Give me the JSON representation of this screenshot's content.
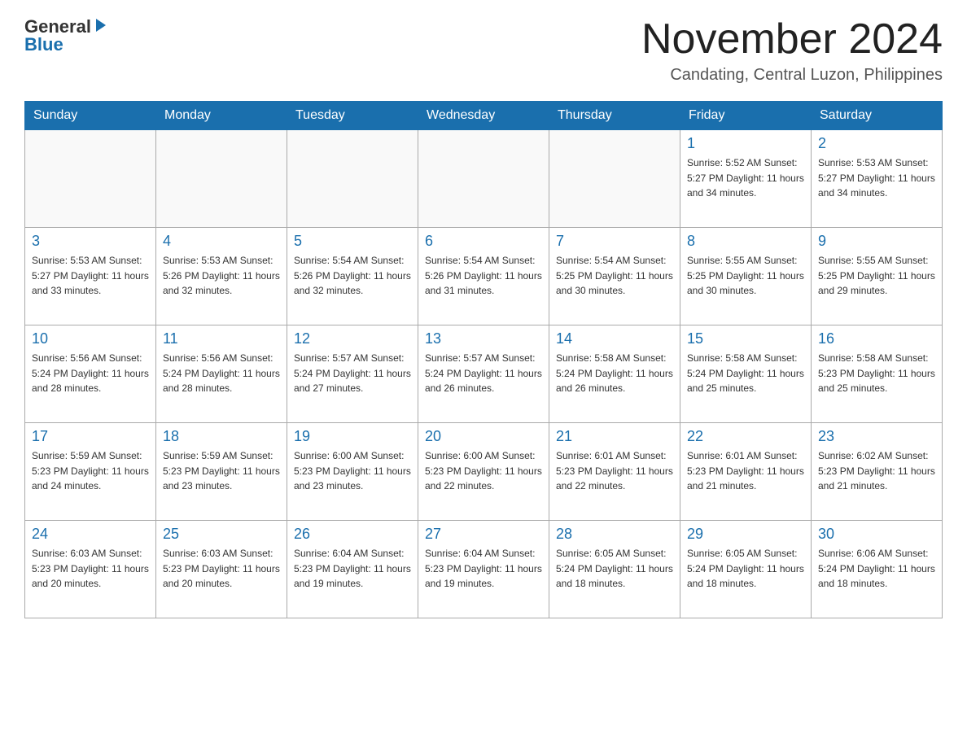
{
  "header": {
    "logo": {
      "general": "General",
      "blue": "Blue",
      "arrow": "▶"
    },
    "title": "November 2024",
    "location": "Candating, Central Luzon, Philippines"
  },
  "calendar": {
    "days_of_week": [
      "Sunday",
      "Monday",
      "Tuesday",
      "Wednesday",
      "Thursday",
      "Friday",
      "Saturday"
    ],
    "weeks": [
      [
        {
          "day": "",
          "info": ""
        },
        {
          "day": "",
          "info": ""
        },
        {
          "day": "",
          "info": ""
        },
        {
          "day": "",
          "info": ""
        },
        {
          "day": "",
          "info": ""
        },
        {
          "day": "1",
          "info": "Sunrise: 5:52 AM\nSunset: 5:27 PM\nDaylight: 11 hours\nand 34 minutes."
        },
        {
          "day": "2",
          "info": "Sunrise: 5:53 AM\nSunset: 5:27 PM\nDaylight: 11 hours\nand 34 minutes."
        }
      ],
      [
        {
          "day": "3",
          "info": "Sunrise: 5:53 AM\nSunset: 5:27 PM\nDaylight: 11 hours\nand 33 minutes."
        },
        {
          "day": "4",
          "info": "Sunrise: 5:53 AM\nSunset: 5:26 PM\nDaylight: 11 hours\nand 32 minutes."
        },
        {
          "day": "5",
          "info": "Sunrise: 5:54 AM\nSunset: 5:26 PM\nDaylight: 11 hours\nand 32 minutes."
        },
        {
          "day": "6",
          "info": "Sunrise: 5:54 AM\nSunset: 5:26 PM\nDaylight: 11 hours\nand 31 minutes."
        },
        {
          "day": "7",
          "info": "Sunrise: 5:54 AM\nSunset: 5:25 PM\nDaylight: 11 hours\nand 30 minutes."
        },
        {
          "day": "8",
          "info": "Sunrise: 5:55 AM\nSunset: 5:25 PM\nDaylight: 11 hours\nand 30 minutes."
        },
        {
          "day": "9",
          "info": "Sunrise: 5:55 AM\nSunset: 5:25 PM\nDaylight: 11 hours\nand 29 minutes."
        }
      ],
      [
        {
          "day": "10",
          "info": "Sunrise: 5:56 AM\nSunset: 5:24 PM\nDaylight: 11 hours\nand 28 minutes."
        },
        {
          "day": "11",
          "info": "Sunrise: 5:56 AM\nSunset: 5:24 PM\nDaylight: 11 hours\nand 28 minutes."
        },
        {
          "day": "12",
          "info": "Sunrise: 5:57 AM\nSunset: 5:24 PM\nDaylight: 11 hours\nand 27 minutes."
        },
        {
          "day": "13",
          "info": "Sunrise: 5:57 AM\nSunset: 5:24 PM\nDaylight: 11 hours\nand 26 minutes."
        },
        {
          "day": "14",
          "info": "Sunrise: 5:58 AM\nSunset: 5:24 PM\nDaylight: 11 hours\nand 26 minutes."
        },
        {
          "day": "15",
          "info": "Sunrise: 5:58 AM\nSunset: 5:24 PM\nDaylight: 11 hours\nand 25 minutes."
        },
        {
          "day": "16",
          "info": "Sunrise: 5:58 AM\nSunset: 5:23 PM\nDaylight: 11 hours\nand 25 minutes."
        }
      ],
      [
        {
          "day": "17",
          "info": "Sunrise: 5:59 AM\nSunset: 5:23 PM\nDaylight: 11 hours\nand 24 minutes."
        },
        {
          "day": "18",
          "info": "Sunrise: 5:59 AM\nSunset: 5:23 PM\nDaylight: 11 hours\nand 23 minutes."
        },
        {
          "day": "19",
          "info": "Sunrise: 6:00 AM\nSunset: 5:23 PM\nDaylight: 11 hours\nand 23 minutes."
        },
        {
          "day": "20",
          "info": "Sunrise: 6:00 AM\nSunset: 5:23 PM\nDaylight: 11 hours\nand 22 minutes."
        },
        {
          "day": "21",
          "info": "Sunrise: 6:01 AM\nSunset: 5:23 PM\nDaylight: 11 hours\nand 22 minutes."
        },
        {
          "day": "22",
          "info": "Sunrise: 6:01 AM\nSunset: 5:23 PM\nDaylight: 11 hours\nand 21 minutes."
        },
        {
          "day": "23",
          "info": "Sunrise: 6:02 AM\nSunset: 5:23 PM\nDaylight: 11 hours\nand 21 minutes."
        }
      ],
      [
        {
          "day": "24",
          "info": "Sunrise: 6:03 AM\nSunset: 5:23 PM\nDaylight: 11 hours\nand 20 minutes."
        },
        {
          "day": "25",
          "info": "Sunrise: 6:03 AM\nSunset: 5:23 PM\nDaylight: 11 hours\nand 20 minutes."
        },
        {
          "day": "26",
          "info": "Sunrise: 6:04 AM\nSunset: 5:23 PM\nDaylight: 11 hours\nand 19 minutes."
        },
        {
          "day": "27",
          "info": "Sunrise: 6:04 AM\nSunset: 5:23 PM\nDaylight: 11 hours\nand 19 minutes."
        },
        {
          "day": "28",
          "info": "Sunrise: 6:05 AM\nSunset: 5:24 PM\nDaylight: 11 hours\nand 18 minutes."
        },
        {
          "day": "29",
          "info": "Sunrise: 6:05 AM\nSunset: 5:24 PM\nDaylight: 11 hours\nand 18 minutes."
        },
        {
          "day": "30",
          "info": "Sunrise: 6:06 AM\nSunset: 5:24 PM\nDaylight: 11 hours\nand 18 minutes."
        }
      ]
    ]
  }
}
